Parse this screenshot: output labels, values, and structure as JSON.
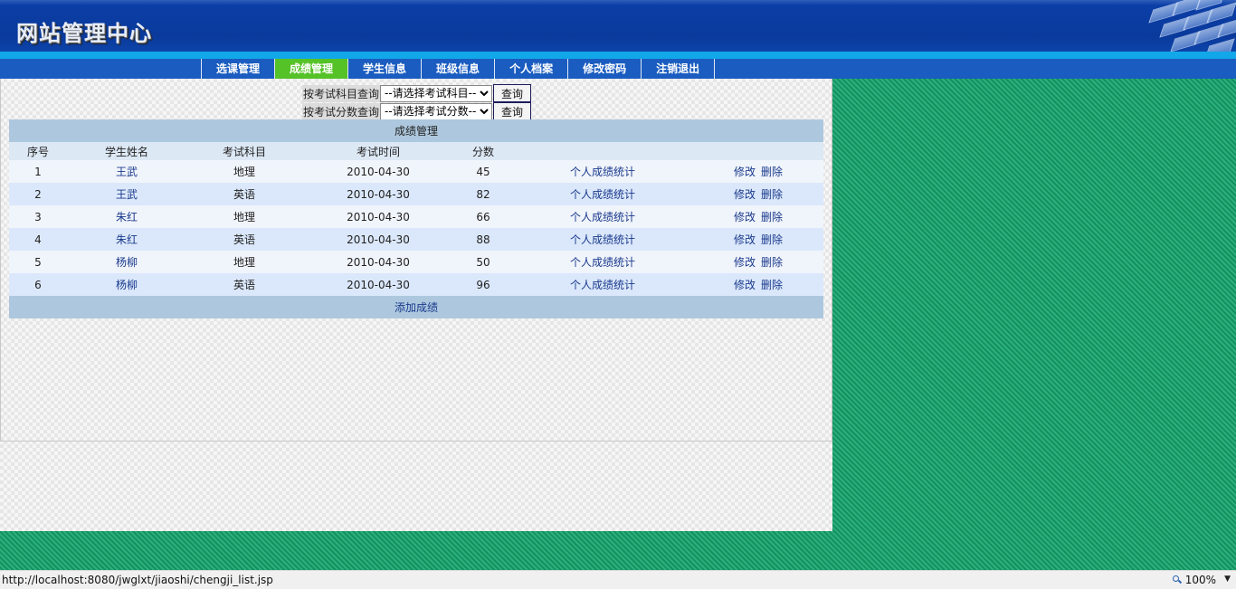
{
  "header": {
    "title": "网站管理中心"
  },
  "nav": {
    "tabs": [
      {
        "label": "选课管理",
        "active": false
      },
      {
        "label": "成绩管理",
        "active": true
      },
      {
        "label": "学生信息",
        "active": false
      },
      {
        "label": "班级信息",
        "active": false
      },
      {
        "label": "个人档案",
        "active": false
      },
      {
        "label": "修改密码",
        "active": false
      },
      {
        "label": "注销退出",
        "active": false
      }
    ]
  },
  "query": {
    "subject_label": "按考试科目查询",
    "subject_selected": "--请选择考试科目--",
    "score_label": "按考试分数查询",
    "score_selected": "--请选择考试分数--",
    "button_label": "查询"
  },
  "table": {
    "caption": "成绩管理",
    "columns": [
      "序号",
      "学生姓名",
      "考试科目",
      "考试时间",
      "分数",
      "",
      ""
    ],
    "rows": [
      {
        "no": "1",
        "name": "王武",
        "subject": "地理",
        "date": "2010-04-30",
        "score": "45"
      },
      {
        "no": "2",
        "name": "王武",
        "subject": "英语",
        "date": "2010-04-30",
        "score": "82"
      },
      {
        "no": "3",
        "name": "朱红",
        "subject": "地理",
        "date": "2010-04-30",
        "score": "66"
      },
      {
        "no": "4",
        "name": "朱红",
        "subject": "英语",
        "date": "2010-04-30",
        "score": "88"
      },
      {
        "no": "5",
        "name": "杨柳",
        "subject": "地理",
        "date": "2010-04-30",
        "score": "50"
      },
      {
        "no": "6",
        "name": "杨柳",
        "subject": "英语",
        "date": "2010-04-30",
        "score": "96"
      }
    ],
    "stats_link": "个人成绩统计",
    "edit_link": "修改",
    "delete_link": "删除",
    "add_link": "添加成绩"
  },
  "statusbar": {
    "url": "http://localhost:8080/jwglxt/jiaoshi/chengji_list.jsp",
    "zoom": "100%",
    "zoom_icon": "magnifier-icon",
    "dropdown_icon": "chevron-down-icon"
  },
  "colors": {
    "header_blue": "#0a3a9c",
    "nav_blue": "#1a5cc0",
    "nav_active": "#55c227",
    "table_caption": "#adc8de",
    "row_light": "#f0f4fb",
    "row_dark": "#dbe8fb",
    "link": "#1a3a8c",
    "background_green": "#1e9c6e"
  }
}
